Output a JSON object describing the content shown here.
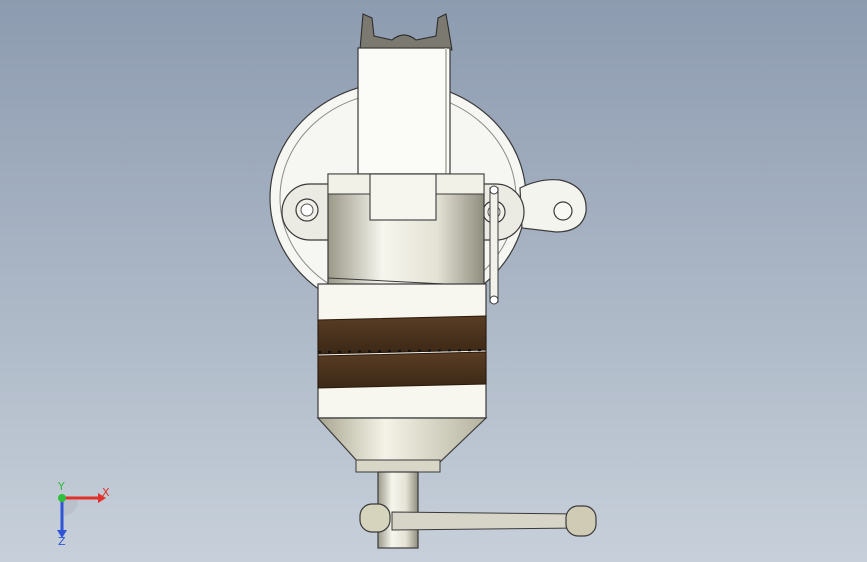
{
  "viewport": {
    "model": "bench-vise-swivel-base",
    "view": "front-orthographic",
    "colors": {
      "background_top": "#8d9bb0",
      "background_bottom": "#c7d0da",
      "part_body": "#f3f1e6",
      "jaw_pad": "#4a3320",
      "edge": "#3a3a3a"
    }
  },
  "triad": {
    "x_label": "X",
    "y_label": "Y",
    "z_label": "Z",
    "x_color": "#e0312a",
    "y_color": "#2fbf3a",
    "z_color": "#2f54d8"
  }
}
